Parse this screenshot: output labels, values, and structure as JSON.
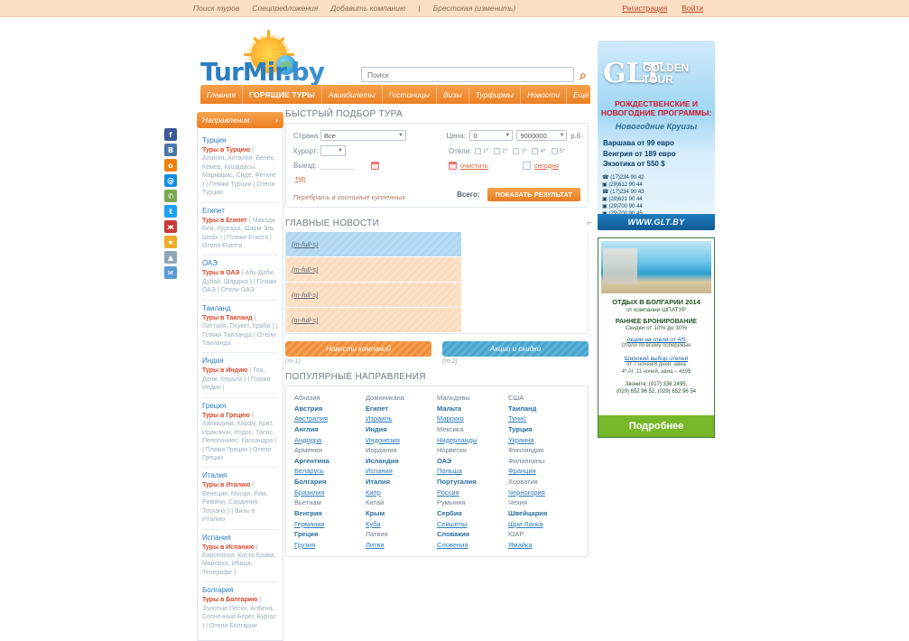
{
  "topbar": {
    "left_links": [
      "Поиск туров",
      "Спецпредложения",
      "Добавить компанию"
    ],
    "separator": "|",
    "region_label": "Брестская (изменить)",
    "right_links": [
      "Регистрация",
      "Войти"
    ]
  },
  "header": {
    "logo": {
      "part1": "Tur",
      "part2": "Mir",
      "part3": ".by"
    },
    "search": {
      "placeholder": "Поиск",
      "value": "",
      "go_icon": "search-icon"
    }
  },
  "nav": {
    "items": [
      {
        "label": "Главная",
        "hot": false
      },
      {
        "label": "ГОРЯЩИЕ ТУРЫ",
        "hot": true
      },
      {
        "label": "Авиабилеты",
        "hot": false
      },
      {
        "label": "Гостиницы",
        "hot": false
      },
      {
        "label": "Визы",
        "hot": false
      },
      {
        "label": "Турфирмы",
        "hot": false
      },
      {
        "label": "Новости",
        "hot": false
      },
      {
        "label": "Ещё",
        "hot": false
      }
    ],
    "caret": "▼"
  },
  "sidebar": {
    "title": "Направления",
    "toggle_icon": "chevron-icon",
    "groups": [
      {
        "country": "Турция",
        "hot": "Туры в Турцию",
        "links": "( Алания, Анталия, Белек, Кемер, Кушадасы, Мармарис, Сиде, Фетхие ) | Пляжи Турции | Отели Турции"
      },
      {
        "country": "Египет",
        "hot": "Туры в Египет",
        "links": "( Макади Бей, Хургада, Шарм Эль Шейх ) | Пляжи Египта | Отели Египта"
      },
      {
        "country": "ОАЭ",
        "hot": "Туры в ОАЭ",
        "links": "( Абу-Даби, Дубай, Шарджа ) | Пляжи ОАЭ | Отели ОАЭ"
      },
      {
        "country": "Таиланд",
        "hot": "Туры в Таиланд",
        "links": "( Паттайя, Пхукет, Краби ) | Пляжи Таиланда | Отели Таиланда"
      },
      {
        "country": "Индия",
        "hot": "Туры в Индию",
        "links": "( Гоа, Дели, Керала ) | Пляжи Индии |"
      },
      {
        "country": "Греция",
        "hot": "Туры в Грецию",
        "links": "( Халкидики, Корфу, Крит, Ираклион, Родос, Тасос, Пелопоннес, Кассандра ) | Пляжи Греции | Отели Греции"
      },
      {
        "country": "Италия",
        "hot": "Туры в Италию",
        "links": "( Венеция, Милан, Рим, Римини, Сардиния, Тоскана ) | Визы в Италию"
      },
      {
        "country": "Испания",
        "hot": "Туры в Испанию",
        "links": "( Барселона, Коста Брава, Майорка, Ибица, Тенерифе )"
      },
      {
        "country": "Болгария",
        "hot": "Туры в Болгарию",
        "links": "( Золотые Пески, Албена, Солнечный Берег, Бургас ) | Отели Болгарии"
      }
    ]
  },
  "social": {
    "items": [
      {
        "name": "facebook-icon",
        "glyph": "f",
        "color": "#3b5998"
      },
      {
        "name": "vkontakte-icon",
        "glyph": "В",
        "color": "#4a76a8"
      },
      {
        "name": "odnoklassniki-icon",
        "glyph": "о",
        "color": "#ee8208"
      },
      {
        "name": "mail-icon",
        "glyph": "@",
        "color": "#168de2"
      },
      {
        "name": "phone-icon",
        "glyph": "✆",
        "color": "#7aa84f"
      },
      {
        "name": "twitter-icon",
        "glyph": "t",
        "color": "#1da1f2"
      },
      {
        "name": "livejournal-icon",
        "glyph": "ж",
        "color": "#c43c3c"
      },
      {
        "name": "favorites-icon",
        "glyph": "★",
        "color": "#f0ad2e"
      },
      {
        "name": "scroll-top-icon",
        "glyph": "▲",
        "color": "#8fa6b5"
      },
      {
        "name": "envelope-icon",
        "glyph": "✉",
        "color": "#5b9bd5"
      }
    ]
  },
  "quick_search": {
    "title": "БЫСТРЫЙ ПОДБОР ТУРА",
    "rss_icon": "rss-icon",
    "country_label": "Страна:",
    "country_value": "Все",
    "resort_label": "Курорт:",
    "resort_value": "",
    "depart_label": "Выезд:",
    "depart_value": "",
    "calendar_icon": "calendar-icon",
    "tour_link": "тур",
    "price_label": "Цена:",
    "price_min": "0",
    "price_max": "9000000",
    "currency": "р.б",
    "hotels_label": "Отели:",
    "stars": [
      "1*",
      "2*",
      "3*",
      "4*",
      "5*"
    ],
    "clear_label": "очистить",
    "hot_label": "сегодня",
    "note": "Перебрать в гостиные купленных",
    "total_label": "Всего:",
    "submit_label": "ПОКАЗАТЬ РЕЗУЛЬТАТ"
  },
  "news": {
    "title": "ГЛАВНЫЕ НОВОСТИ",
    "rows": [
      {
        "text": "(m-full-s)",
        "style": "sel"
      },
      {
        "text": "(m-full-s)",
        "style": "alt"
      },
      {
        "text": "(m-full-s)",
        "style": "alt"
      },
      {
        "text": "(m-full-s)",
        "style": "alt"
      }
    ],
    "buttons": [
      {
        "label": "Новости компаний",
        "caption": "(m-1)",
        "style": "orange"
      },
      {
        "label": "Акции и скидки",
        "caption": "(m-2)",
        "style": "blue"
      }
    ]
  },
  "destinations": {
    "title": "ПОПУЛЯРНЫЕ НАПРАВЛЕНИЯ",
    "columns": [
      [
        {
          "name": "Абхазия",
          "style": "plain"
        },
        {
          "name": "Австрия",
          "style": "b"
        },
        {
          "name": "Австралия",
          "style": "u"
        },
        {
          "name": "Англия",
          "style": "b"
        },
        {
          "name": "Андорра",
          "style": "u"
        },
        {
          "name": "Армения",
          "style": "plain"
        },
        {
          "name": "Аргентина",
          "style": "b"
        },
        {
          "name": "Беларусь",
          "style": "u"
        },
        {
          "name": "Болгария",
          "style": "b"
        },
        {
          "name": "Бразилия",
          "style": "u"
        },
        {
          "name": "Вьетнам",
          "style": "plain"
        },
        {
          "name": "Венгрия",
          "style": "b"
        },
        {
          "name": "Германия",
          "style": "u"
        },
        {
          "name": "Греция",
          "style": "b"
        },
        {
          "name": "Грузия",
          "style": "u"
        }
      ],
      [
        {
          "name": "Доминикана",
          "style": "plain"
        },
        {
          "name": "Египет",
          "style": "b"
        },
        {
          "name": "Израиль",
          "style": "u"
        },
        {
          "name": "Индия",
          "style": "b"
        },
        {
          "name": "Индонезия",
          "style": "u"
        },
        {
          "name": "Иордания",
          "style": "plain"
        },
        {
          "name": "Исландия",
          "style": "b"
        },
        {
          "name": "Испания",
          "style": "u"
        },
        {
          "name": "Италия",
          "style": "b"
        },
        {
          "name": "Кипр",
          "style": "u"
        },
        {
          "name": "Китай",
          "style": "plain"
        },
        {
          "name": "Крым",
          "style": "b"
        },
        {
          "name": "Куба",
          "style": "u"
        },
        {
          "name": "Латвия",
          "style": "plain"
        },
        {
          "name": "Литва",
          "style": "u"
        }
      ],
      [
        {
          "name": "Мальдивы",
          "style": "plain"
        },
        {
          "name": "Мальта",
          "style": "b"
        },
        {
          "name": "Марокко",
          "style": "u"
        },
        {
          "name": "Мексика",
          "style": "plain"
        },
        {
          "name": "Нидерланды",
          "style": "u"
        },
        {
          "name": "Норвегия",
          "style": "plain"
        },
        {
          "name": "ОАЭ",
          "style": "b"
        },
        {
          "name": "Польша",
          "style": "u"
        },
        {
          "name": "Португалия",
          "style": "b"
        },
        {
          "name": "Россия",
          "style": "u"
        },
        {
          "name": "Румыния",
          "style": "plain"
        },
        {
          "name": "Сербия",
          "style": "b"
        },
        {
          "name": "Сейшелы",
          "style": "u"
        },
        {
          "name": "Словакия",
          "style": "b"
        },
        {
          "name": "Словения",
          "style": "u"
        }
      ],
      [
        {
          "name": "США",
          "style": "plain"
        },
        {
          "name": "Таиланд",
          "style": "b"
        },
        {
          "name": "Тунис",
          "style": "u"
        },
        {
          "name": "Турция",
          "style": "b"
        },
        {
          "name": "Украина",
          "style": "u"
        },
        {
          "name": "Финляндия",
          "style": "plain"
        },
        {
          "name": "Филиппины",
          "style": "plain"
        },
        {
          "name": "Франция",
          "style": "u"
        },
        {
          "name": "Хорватия",
          "style": "plain"
        },
        {
          "name": "Черногория",
          "style": "u"
        },
        {
          "name": "Чехия",
          "style": "plain"
        },
        {
          "name": "Швейцария",
          "style": "b"
        },
        {
          "name": "Шри-Ланка",
          "style": "u"
        },
        {
          "name": "ЮАР",
          "style": "plain"
        },
        {
          "name": "Ямайка",
          "style": "u"
        }
      ]
    ]
  },
  "banner_golden_tour": {
    "brand_mark": "GLT",
    "brand_word1": "GOLDEN",
    "brand_word2": "TOUR",
    "headline1": "РОЖДЕСТВЕНСКИЕ И",
    "headline2": "НОВОГОДНИЕ ПРОГРАММЫ:",
    "subhead": "Новогодние Круизы",
    "prices": [
      "Варшава от 99 евро",
      "Венгрия от 189 евро",
      "Экзотика от 550 $"
    ],
    "phones": [
      "☎ (17)234 90 42",
      "▣ (29)612 90 44",
      "☎ (17)234 90 43",
      "▣ (29)621 90 44",
      "▣ (29)700 90 44",
      "▣ (29)700 90 45"
    ],
    "site": "WWW.GLT.BY"
  },
  "banner_bulgaria": {
    "title1": "ОТДЫХ В БОЛГАРИИ 2014",
    "title2": "от компании ШПАТУР",
    "subtitle1": "РАННЕЕ БРОНИРОВАНИЕ",
    "subtitle2": "Скидки от 10% до 30%",
    "link1": "Акции на отели от 4/5",
    "note1": "Отели по всему побережью",
    "link2": "Широкий выбор отелей",
    "note2": "от 7 ночей/8 дней, авиа",
    "note3": "4* AI, 11 ночей, авиа – 489$",
    "phone": "Звоните: (017) 336 2495,",
    "phone2": "(029) 652 96 52, (029) 652 96 54",
    "cta": "Подробнее"
  }
}
